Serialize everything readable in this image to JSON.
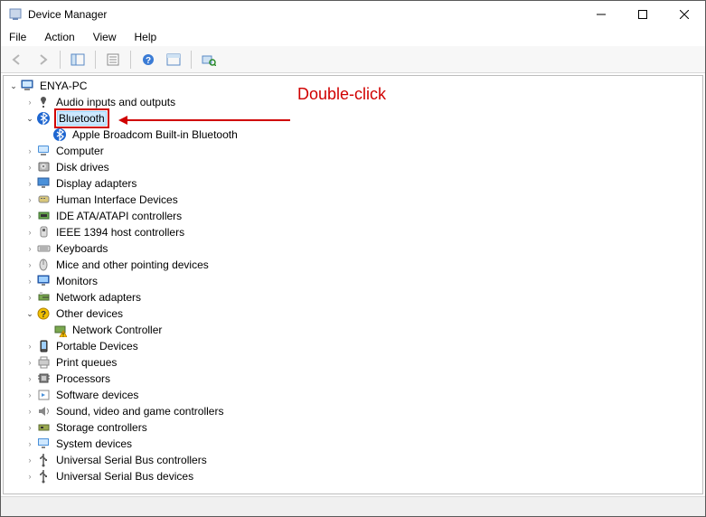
{
  "window": {
    "title": "Device Manager"
  },
  "menu": {
    "file": "File",
    "action": "Action",
    "view": "View",
    "help": "Help"
  },
  "toolbar": {
    "back": "Back",
    "forward": "Forward",
    "show_hide": "Show/Hide Console Tree",
    "properties": "Properties",
    "help": "Help",
    "action_bar": "Action",
    "scan": "Scan for hardware changes"
  },
  "annotation": {
    "text": "Double-click"
  },
  "tree": {
    "root": {
      "label": "ENYA-PC"
    },
    "items": [
      {
        "label": "Audio inputs and outputs",
        "icon": "audio"
      },
      {
        "label": "Bluetooth",
        "icon": "bluetooth",
        "expanded": true,
        "selected": true,
        "highlighted": true,
        "children": [
          {
            "label": "Apple Broadcom Built-in Bluetooth",
            "icon": "bluetooth"
          }
        ]
      },
      {
        "label": "Computer",
        "icon": "computer"
      },
      {
        "label": "Disk drives",
        "icon": "disk"
      },
      {
        "label": "Display adapters",
        "icon": "display"
      },
      {
        "label": "Human Interface Devices",
        "icon": "hid"
      },
      {
        "label": "IDE ATA/ATAPI controllers",
        "icon": "ide"
      },
      {
        "label": "IEEE 1394 host controllers",
        "icon": "firewire"
      },
      {
        "label": "Keyboards",
        "icon": "keyboard"
      },
      {
        "label": "Mice and other pointing devices",
        "icon": "mouse"
      },
      {
        "label": "Monitors",
        "icon": "monitor"
      },
      {
        "label": "Network adapters",
        "icon": "network"
      },
      {
        "label": "Other devices",
        "icon": "other",
        "expanded": true,
        "children": [
          {
            "label": "Network Controller",
            "icon": "other-warn"
          }
        ]
      },
      {
        "label": "Portable Devices",
        "icon": "portable"
      },
      {
        "label": "Print queues",
        "icon": "printer"
      },
      {
        "label": "Processors",
        "icon": "cpu"
      },
      {
        "label": "Software devices",
        "icon": "software"
      },
      {
        "label": "Sound, video and game controllers",
        "icon": "sound"
      },
      {
        "label": "Storage controllers",
        "icon": "storage"
      },
      {
        "label": "System devices",
        "icon": "system"
      },
      {
        "label": "Universal Serial Bus controllers",
        "icon": "usb"
      },
      {
        "label": "Universal Serial Bus devices",
        "icon": "usb"
      }
    ]
  }
}
